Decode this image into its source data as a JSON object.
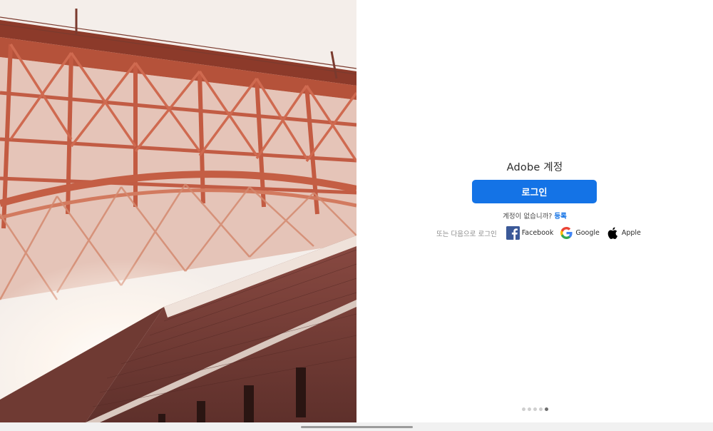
{
  "hero": {
    "image": "golden-gate-bridge-underside-photo"
  },
  "login": {
    "title": "Adobe 계정",
    "sign_in_label": "로그인",
    "no_account_text": "계정이 없습니까?",
    "register_link": "등록",
    "or_text": "또는 다음으로 로그인",
    "providers": [
      {
        "label": "Facebook",
        "icon": "facebook-icon",
        "color": "#3b5998"
      },
      {
        "label": "Google",
        "icon": "google-icon"
      },
      {
        "label": "Apple",
        "icon": "apple-icon",
        "color": "#000000"
      }
    ]
  },
  "carousel": {
    "count": 5,
    "active_index": 4
  },
  "colors": {
    "accent": "#1473e6",
    "brick": "#7a3d34",
    "steel": "#c9644a"
  }
}
